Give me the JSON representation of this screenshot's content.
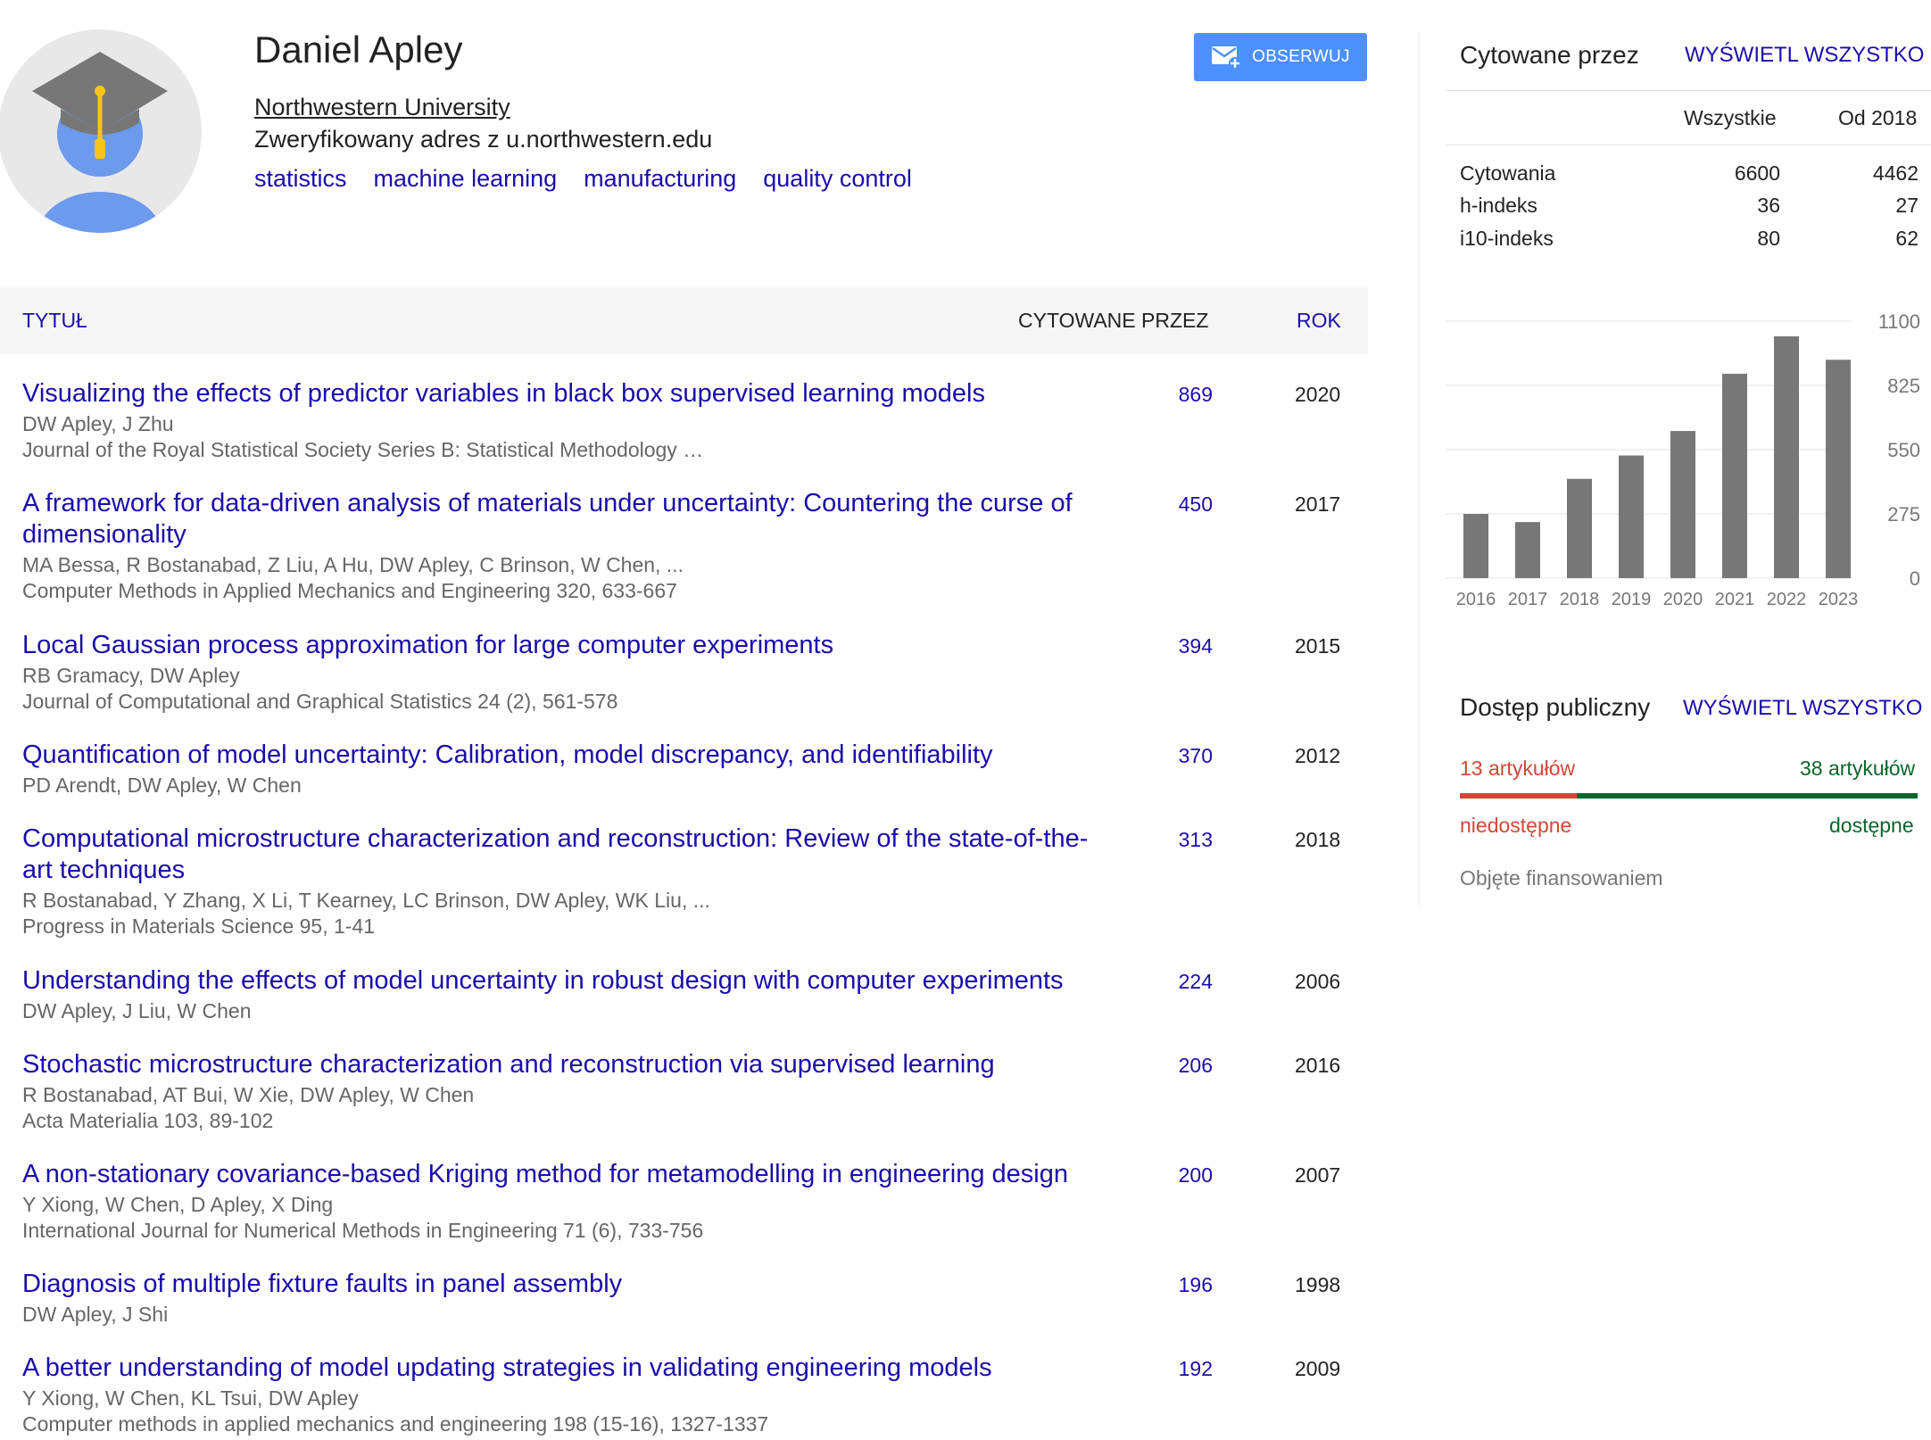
{
  "profile": {
    "name": "Daniel Apley",
    "affiliation": "Northwestern University",
    "email": "Zweryfikowany adres z u.northwestern.edu",
    "interests": [
      "statistics",
      "machine learning",
      "manufacturing",
      "quality control"
    ],
    "follow_label": "OBSERWUJ",
    "avatar_icon": "graduate-avatar-icon",
    "follow_icon": "mail-plus-icon"
  },
  "table": {
    "headers": {
      "title": "TYTUŁ",
      "cited_by": "CYTOWANE PRZEZ",
      "year": "ROK"
    },
    "rows": [
      {
        "title": "Visualizing the effects of predictor variables in black box supervised learning models",
        "authors": "DW Apley, J Zhu",
        "venue": "Journal of the Royal Statistical Society Series B: Statistical Methodology …",
        "cites": "869",
        "year": "2020"
      },
      {
        "title": "A framework for data-driven analysis of materials under uncertainty: Countering the curse of dimensionality",
        "authors": "MA Bessa, R Bostanabad, Z Liu, A Hu, DW Apley, C Brinson, W Chen, ...",
        "venue": "Computer Methods in Applied Mechanics and Engineering 320, 633-667",
        "cites": "450",
        "year": "2017"
      },
      {
        "title": "Local Gaussian process approximation for large computer experiments",
        "authors": "RB Gramacy, DW Apley",
        "venue": "Journal of Computational and Graphical Statistics 24 (2), 561-578",
        "cites": "394",
        "year": "2015"
      },
      {
        "title": "Quantification of model uncertainty: Calibration, model discrepancy, and identifiability",
        "authors": "PD Arendt, DW Apley, W Chen",
        "venue": "",
        "cites": "370",
        "year": "2012"
      },
      {
        "title": "Computational microstructure characterization and reconstruction: Review of the state-of-the-art techniques",
        "authors": "R Bostanabad, Y Zhang, X Li, T Kearney, LC Brinson, DW Apley, WK Liu, ...",
        "venue": "Progress in Materials Science 95, 1-41",
        "cites": "313",
        "year": "2018"
      },
      {
        "title": "Understanding the effects of model uncertainty in robust design with computer experiments",
        "authors": "DW Apley, J Liu, W Chen",
        "venue": "",
        "cites": "224",
        "year": "2006"
      },
      {
        "title": "Stochastic microstructure characterization and reconstruction via supervised learning",
        "authors": "R Bostanabad, AT Bui, W Xie, DW Apley, W Chen",
        "venue": "Acta Materialia 103, 89-102",
        "cites": "206",
        "year": "2016"
      },
      {
        "title": "A non-stationary covariance-based Kriging method for metamodelling in engineering design",
        "authors": "Y Xiong, W Chen, D Apley, X Ding",
        "venue": "International Journal for Numerical Methods in Engineering 71 (6), 733-756",
        "cites": "200",
        "year": "2007"
      },
      {
        "title": "Diagnosis of multiple fixture faults in panel assembly",
        "authors": "DW Apley, J Shi",
        "venue": "",
        "cites": "196",
        "year": "1998"
      },
      {
        "title": "A better understanding of model updating strategies in validating engineering models",
        "authors": "Y Xiong, W Chen, KL Tsui, DW Apley",
        "venue": "Computer methods in applied mechanics and engineering 198 (15-16), 1327-1337",
        "cites": "192",
        "year": "2009"
      }
    ]
  },
  "cited_by": {
    "title": "Cytowane przez",
    "view_all": "WYŚWIETL WSZYSTKO",
    "col_all": "Wszystkie",
    "col_since": "Od 2018",
    "stats": [
      {
        "label": "Cytowania",
        "all": "6600",
        "since": "4462"
      },
      {
        "label": "h-indeks",
        "all": "36",
        "since": "27"
      },
      {
        "label": "i10-indeks",
        "all": "80",
        "since": "62"
      }
    ]
  },
  "chart_data": {
    "type": "bar",
    "categories": [
      "2016",
      "2017",
      "2018",
      "2019",
      "2020",
      "2021",
      "2022",
      "2023"
    ],
    "values": [
      275,
      240,
      425,
      525,
      630,
      875,
      1035,
      935
    ],
    "ylim": [
      0,
      1100
    ],
    "yticks": [
      "1100",
      "825",
      "550",
      "275",
      "0"
    ],
    "grid": true,
    "bar_color": "#777777"
  },
  "public_access": {
    "title": "Dostęp publiczny",
    "view_all": "WYŚWIETL WSZYSTKO",
    "unavailable_count": "13 artykułów",
    "available_count": "38 artykułów",
    "unavailable_label": "niedostępne",
    "available_label": "dostępne",
    "funded_label": "Objęte finansowaniem",
    "unavailable_fraction": 0.255,
    "unavailable_color": "#d14836",
    "available_color": "#0d652d"
  }
}
